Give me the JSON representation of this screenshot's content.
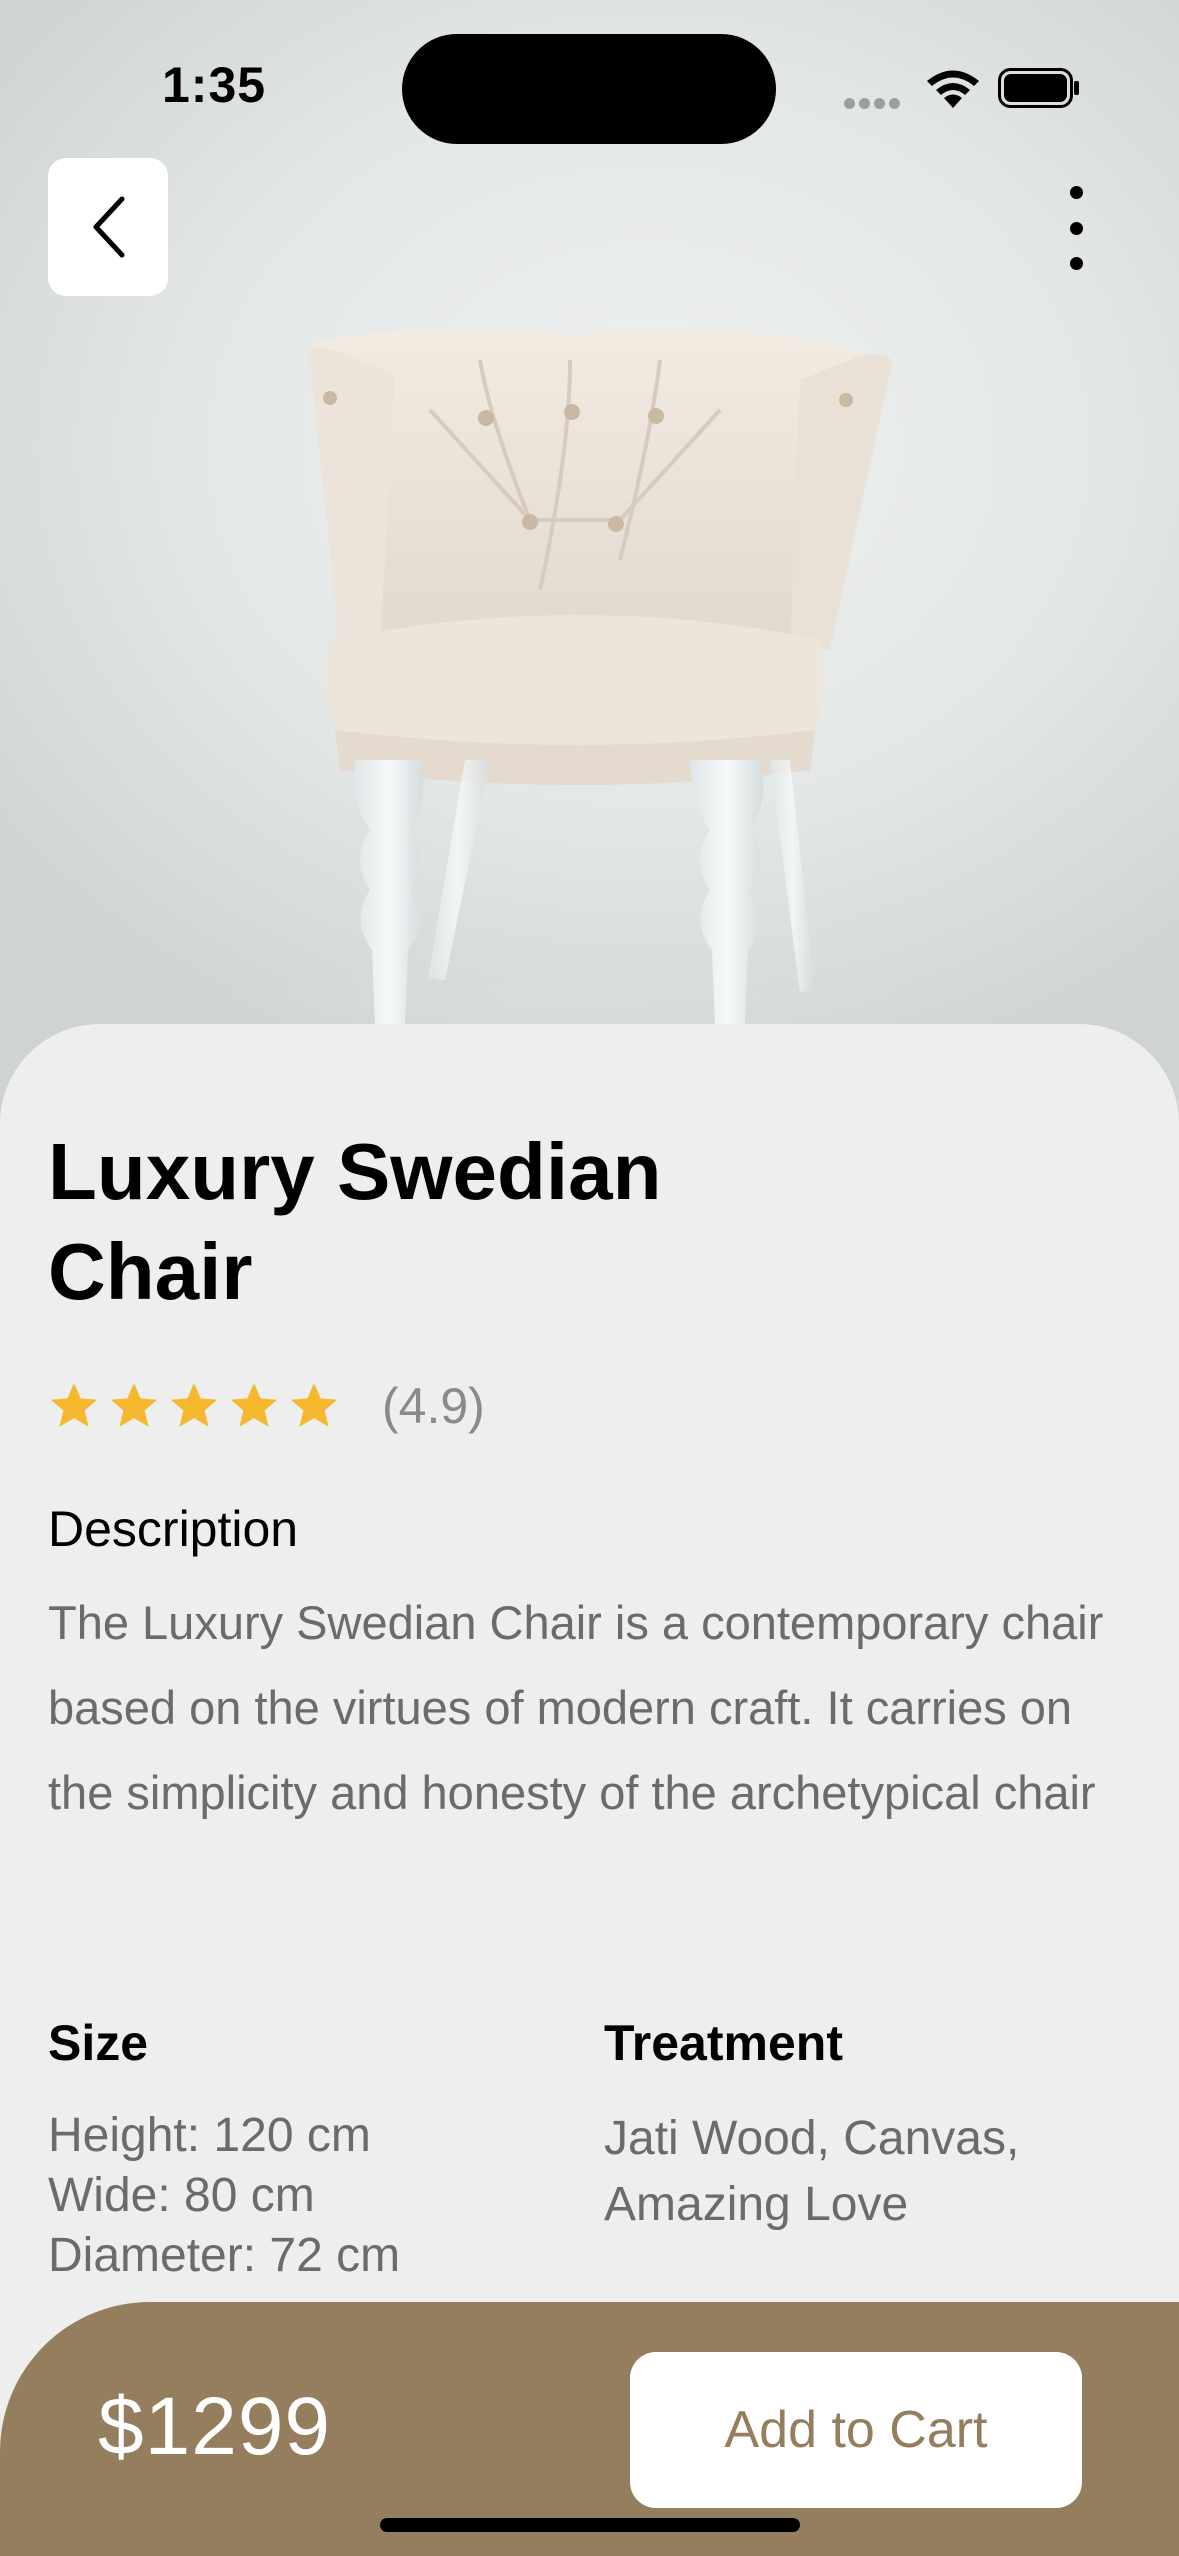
{
  "status_bar": {
    "time": "1:35"
  },
  "nav": {
    "back_icon": "chevron-left-icon",
    "more_icon": "more-vertical-icon"
  },
  "hero": {
    "image": "white-tufted-chair-photo"
  },
  "product": {
    "title": "Luxury Swedian Chair",
    "rating_stars": 5,
    "rating_value": "(4.9)",
    "description_heading": "Description",
    "description": "The Luxury Swedian Chair is a contemporary chair based on the virtues of modern craft. It carries on the simplicity and honesty of the archetypical chair",
    "size": {
      "heading": "Size",
      "height": "Height: 120 cm",
      "wide": "Wide: 80 cm",
      "diameter": "Diameter: 72 cm"
    },
    "treatment": {
      "heading": "Treatment",
      "text": "Jati Wood, Canvas, Amazing Love"
    }
  },
  "bottom_bar": {
    "price": "$1299",
    "add_to_cart_label": "Add to Cart"
  },
  "colors": {
    "accent": "#957e5e",
    "star": "#f5b82e",
    "sheet_bg": "#eeeeee"
  }
}
